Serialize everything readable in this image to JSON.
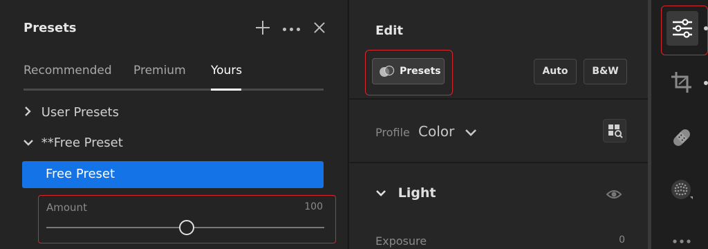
{
  "presets_panel": {
    "title": "Presets",
    "tabs": [
      {
        "label": "Recommended"
      },
      {
        "label": "Premium"
      },
      {
        "label": "Yours"
      }
    ],
    "active_tab": "Yours",
    "tree": [
      {
        "label": "User Presets",
        "expanded": false
      },
      {
        "label": "**Free Preset",
        "expanded": true
      }
    ],
    "selected_preset": "Free Preset",
    "amount": {
      "label": "Amount",
      "value": "100",
      "level": 0.5
    }
  },
  "edit_panel": {
    "title": "Edit",
    "presets_button": "Presets",
    "auto_button": "Auto",
    "bw_button": "B&W",
    "profile_label": "Profile",
    "profile_value": "Color",
    "light_section": "Light",
    "exposure_label": "Exposure",
    "exposure_value": "0"
  },
  "tool_strip": {
    "tools": [
      "sliders-icon",
      "crop-icon",
      "healing-icon",
      "masking-icon",
      "more-icon"
    ]
  },
  "colors": {
    "accent": "#1473e6",
    "highlight_border": "#d7262e",
    "panel_bg": "#242424"
  }
}
